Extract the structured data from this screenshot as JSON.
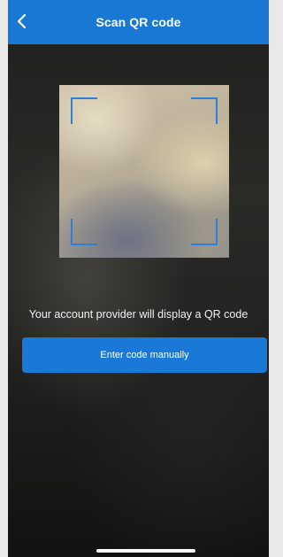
{
  "header": {
    "title": "Scan QR code",
    "back_icon": "chevron-left-icon"
  },
  "scanner": {
    "frame": "qr-scan-frame"
  },
  "instruction_text": "Your account provider will display a QR code",
  "manual_button_label": "Enter code manually",
  "colors": {
    "accent": "#1878d4",
    "corner": "#2f7fd6"
  }
}
